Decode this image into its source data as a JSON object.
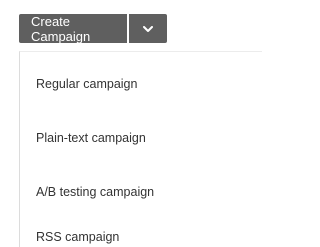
{
  "split_button": {
    "label": "Create Campaign",
    "caret_icon": "chevron-down-icon",
    "background_color": "#5f5f5f",
    "text_color": "#ffffff"
  },
  "menu": {
    "items": [
      {
        "label": "Regular campaign"
      },
      {
        "label": "Plain-text campaign"
      },
      {
        "label": "A/B testing campaign"
      },
      {
        "label": "RSS campaign"
      }
    ]
  }
}
